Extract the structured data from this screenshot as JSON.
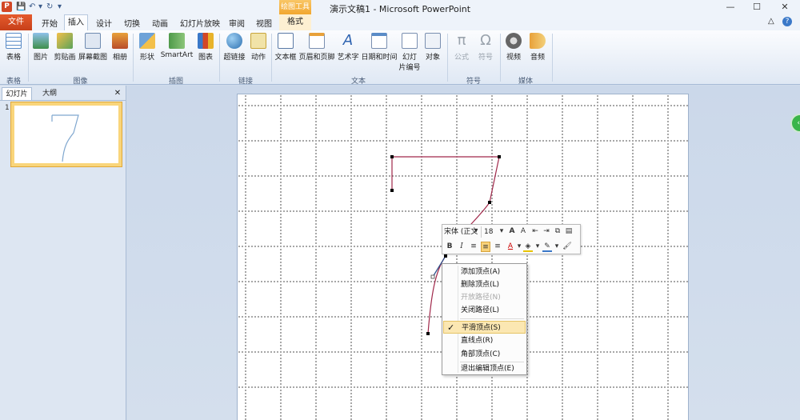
{
  "titlebar": {
    "app_icon": "P",
    "title": "演示文稿1 - Microsoft PowerPoint",
    "contextual_tab_group": "绘图工具",
    "qat": {
      "save_icon": "save-icon",
      "undo_icon": "undo-icon",
      "redo_icon": "redo-icon"
    },
    "controls": {
      "minimize": "—",
      "maximize": "☐",
      "close": "✕"
    }
  },
  "tabs": {
    "file": "文件",
    "items": [
      "开始",
      "插入",
      "设计",
      "切换",
      "动画",
      "幻灯片放映",
      "审阅",
      "视图"
    ],
    "active": "插入",
    "format": "格式"
  },
  "ribbon": {
    "groups": [
      {
        "label": "表格",
        "buttons": [
          "表格"
        ]
      },
      {
        "label": "图像",
        "buttons": [
          "图片",
          "剪贴画",
          "屏幕截图",
          "相册"
        ]
      },
      {
        "label": "插图",
        "buttons": [
          "形状",
          "SmartArt",
          "图表"
        ]
      },
      {
        "label": "链接",
        "buttons": [
          "超链接",
          "动作"
        ]
      },
      {
        "label": "文本",
        "buttons": [
          "文本框",
          "页眉和页脚",
          "艺术字",
          "日期和时间",
          "幻灯片编号"
        ]
      },
      {
        "label": "符号",
        "buttons": [
          "公式",
          "符号"
        ]
      },
      {
        "label": "媒体",
        "buttons": [
          "视频",
          "音频"
        ]
      }
    ],
    "object_label": "对象",
    "slide_number_line2": "片编号",
    "slide_number_line1": "幻灯"
  },
  "panel": {
    "tabs": [
      "幻灯片",
      "大纲"
    ],
    "close": "✕",
    "slide_number": "1"
  },
  "minitoolbar": {
    "font": "宋体 (正文",
    "size": "18",
    "bold": "B",
    "italic": "I"
  },
  "context_menu": {
    "items": [
      {
        "label": "添加顶点(A)",
        "enabled": true
      },
      {
        "label": "删除顶点(L)",
        "enabled": true
      },
      {
        "label": "开放路径(N)",
        "enabled": false
      },
      {
        "label": "关闭路径(L)",
        "enabled": true
      },
      {
        "label": "平滑顶点(S)",
        "enabled": true,
        "checked": true
      },
      {
        "label": "直线点(R)",
        "enabled": true
      },
      {
        "label": "角部顶点(C)",
        "enabled": true
      },
      {
        "label": "退出编辑顶点(E)",
        "enabled": true
      }
    ],
    "check_mark": "✓"
  },
  "colors": {
    "file_tab": "#d24726",
    "path_stroke": "#a0284a",
    "thumb_stroke": "#7fa7cf",
    "checked_item": "#fbe7b2"
  }
}
